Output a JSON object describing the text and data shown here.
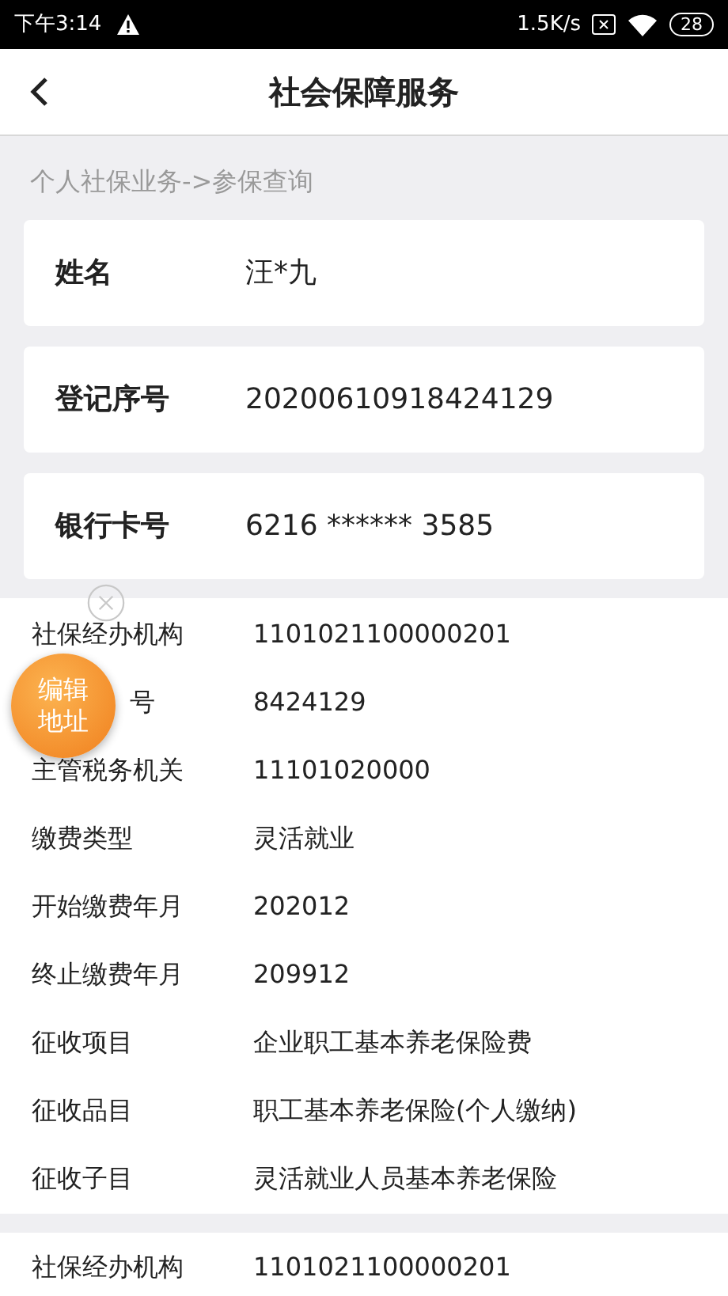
{
  "status_bar": {
    "time": "下午3:14",
    "speed": "1.5K/s",
    "battery": "28"
  },
  "header": {
    "title": "社会保障服务"
  },
  "breadcrumb": "个人社保业务->参保查询",
  "cards": [
    {
      "label": "姓名",
      "value": "汪*九"
    },
    {
      "label": "登记序号",
      "value": "20200610918424129"
    },
    {
      "label": "银行卡号",
      "value": "6216 ****** 3585"
    }
  ],
  "records": [
    {
      "rows": [
        {
          "kind": "full",
          "label": "社保经办机构",
          "value": "1101021100000201"
        },
        {
          "kind": "covered",
          "label": "号",
          "value": "8424129"
        },
        {
          "kind": "full",
          "label": "主管税务机关",
          "value": "11101020000"
        },
        {
          "kind": "full",
          "label": "缴费类型",
          "value": "灵活就业"
        },
        {
          "kind": "full",
          "label": "开始缴费年月",
          "value": "202012"
        },
        {
          "kind": "full",
          "label": "终止缴费年月",
          "value": "209912"
        },
        {
          "kind": "full",
          "label": "征收项目",
          "value": "企业职工基本养老保险费"
        },
        {
          "kind": "full",
          "label": "征收品目",
          "value": "职工基本养老保险(个人缴纳)"
        },
        {
          "kind": "full",
          "label": "征收子目",
          "value": "灵活就业人员基本养老保险"
        }
      ]
    },
    {
      "rows": [
        {
          "kind": "full",
          "label": "社保经办机构",
          "value": "1101021100000201"
        }
      ]
    }
  ],
  "floating_button": {
    "lines": [
      "编辑",
      "地址"
    ]
  }
}
